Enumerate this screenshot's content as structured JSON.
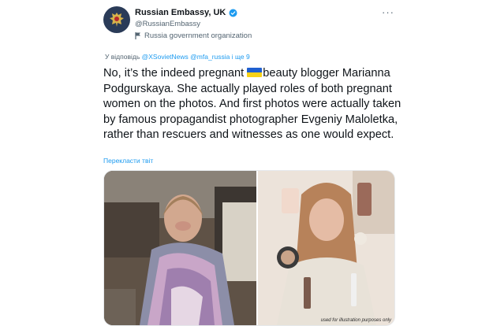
{
  "author": {
    "display_name": "Russian Embassy, UK",
    "handle": "@RussianEmbassy",
    "label": "Russia government organization"
  },
  "reply": {
    "prefix": "У відповідь",
    "mentions": "@XSovietNews @mfa_russia і ще 9"
  },
  "tweet": {
    "text_before_flag": "No, it’s the indeed pregnant",
    "text_after_flag": "beauty blogger Marianna Podgurskaya. She actually played roles of both pregnant women on the photos. And first photos were actually taken by famous propagandist photographer Evgeniy Maloletka, rather than rescuers and witnesses as one would expect.",
    "translate_link": "Перекласти твіт"
  },
  "media": {
    "watermark": "used for illustration purposes only"
  },
  "icons": {
    "avatar": "russian-coat-of-arms",
    "verified": "verified-badge-icon",
    "gov": "flag-icon",
    "more": "more-icon",
    "inline_flag": "ukraine-flag-emoji"
  },
  "colors": {
    "accent": "#1d9bf0",
    "text": "#0f1419",
    "muted": "#536471"
  }
}
